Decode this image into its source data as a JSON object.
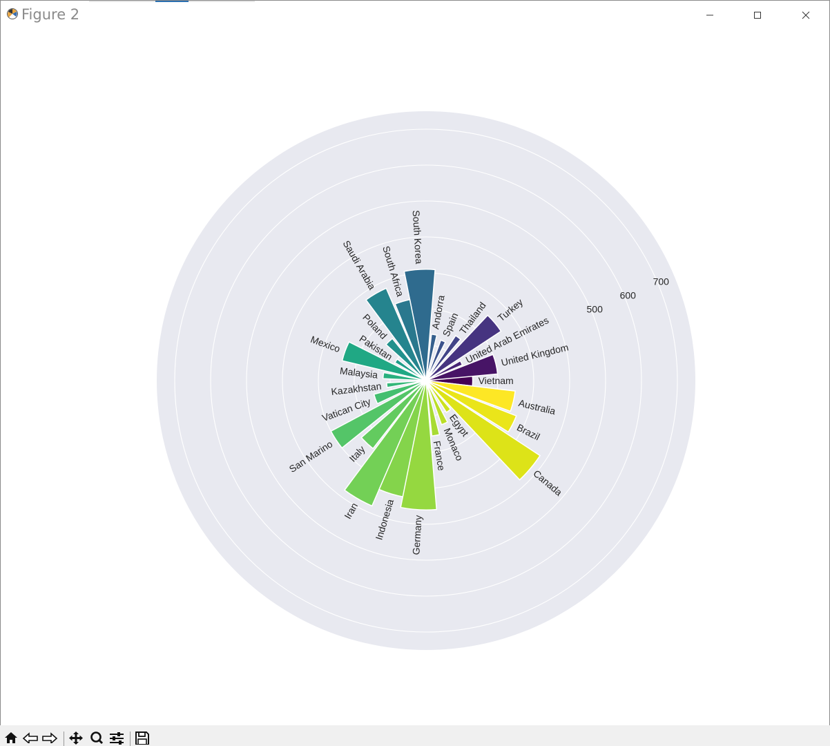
{
  "window": {
    "title": "Figure 2"
  },
  "chart_data": {
    "type": "bar",
    "projection": "polar",
    "style": "seaborn background",
    "colormap": "viridis",
    "grid": true,
    "rlim": [
      0,
      750
    ],
    "r_ticks": [
      500,
      600,
      700
    ],
    "r_tick_labels": [
      "500",
      "600",
      "700"
    ],
    "categories": [
      "Vietnam",
      "United Kingdom",
      "United Arab Emirates",
      "Turkey",
      "Thailand",
      "Spain",
      "Andorra",
      "South Korea",
      "South Africa",
      "Saudi Arabia",
      "Poland",
      "Pakistan",
      "Mexico",
      "Malaysia",
      "Kazakhstan",
      "Vatican City",
      "San Marino",
      "Italy",
      "Iran",
      "Indonesia",
      "Germany",
      "France",
      "Monaco",
      "Egypt",
      "Canada",
      "Brazil",
      "Australia"
    ],
    "values": [
      130,
      200,
      110,
      250,
      150,
      120,
      130,
      310,
      230,
      280,
      150,
      100,
      240,
      120,
      110,
      150,
      300,
      240,
      380,
      330,
      360,
      155,
      130,
      105,
      380,
      270,
      250
    ],
    "bar_widths": [
      1,
      1.2,
      0.5,
      1,
      0.5,
      0.5,
      0.5,
      1.2,
      0.8,
      1,
      0.7,
      0.5,
      1,
      0.6,
      0.5,
      0.8,
      0.8,
      0.8,
      1,
      1,
      1.2,
      0.6,
      0.6,
      0.6,
      1,
      0.8,
      1
    ],
    "colors": [
      "#440154",
      "#471466",
      "#482475",
      "#463480",
      "#414487",
      "#3b528b",
      "#355f8d",
      "#2f6b8e",
      "#2a788e",
      "#25848e",
      "#21918c",
      "#1e9c89",
      "#20a884",
      "#2ab07f",
      "#35b779",
      "#44bf70",
      "#54c568",
      "#63cb5f",
      "#73d056",
      "#84d44b",
      "#95d840",
      "#a8db34",
      "#bade28",
      "#cce11e",
      "#dde318",
      "#eae51a",
      "#fde725"
    ]
  },
  "toolbar": {
    "buttons": [
      {
        "name": "home-icon"
      },
      {
        "name": "back-icon"
      },
      {
        "name": "forward-icon"
      },
      {
        "name": "pan-icon"
      },
      {
        "name": "zoom-icon"
      },
      {
        "name": "subplots-icon"
      },
      {
        "name": "save-icon"
      }
    ]
  }
}
